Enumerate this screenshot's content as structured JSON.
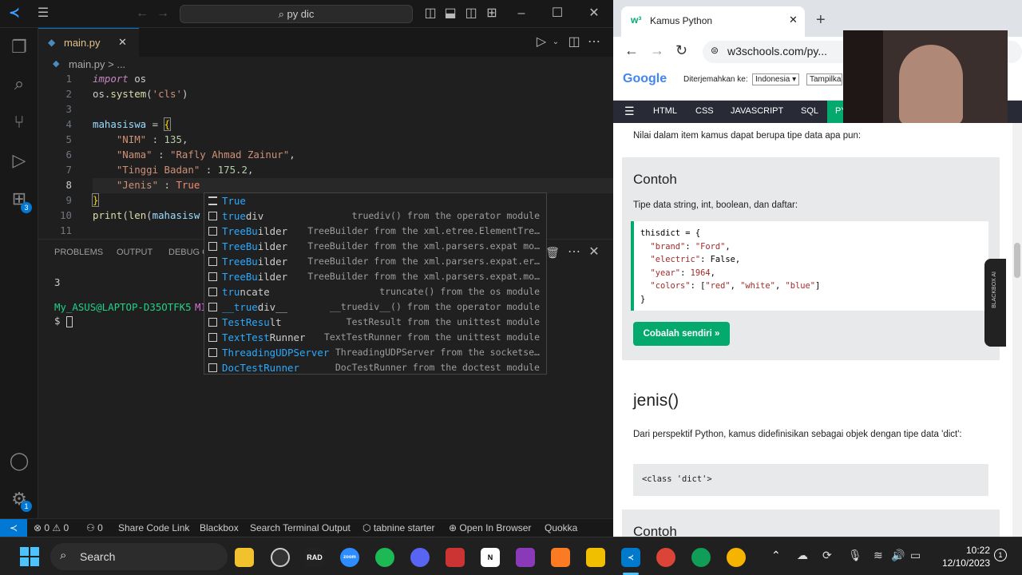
{
  "vscode": {
    "command_center": "py dic",
    "tab_label": "main.py",
    "breadcrumb": "main.py > ...",
    "line_numbers": [
      "1",
      "2",
      "3",
      "4",
      "5",
      "6",
      "7",
      "8",
      "9",
      "10",
      "11"
    ],
    "panel_tabs": [
      "PROBLEMS",
      "OUTPUT",
      "DEBUG C"
    ],
    "terminal": {
      "output": "3",
      "prompt_user": "My_ASUS@LAPTOP-D35OTFK5",
      "prompt_suffix": "MI",
      "prompt": "$"
    },
    "suggestions": [
      {
        "name": "True",
        "match": "True",
        "rest": "",
        "desc": "",
        "selected": true
      },
      {
        "name": "truediv",
        "match": "true",
        "rest": "div",
        "desc": "truediv() from the operator module"
      },
      {
        "name": "TreeBuilder",
        "match": "TreeBu",
        "rest": "ilder",
        "desc": "TreeBuilder from the xml.etree.ElementTre…"
      },
      {
        "name": "TreeBuilder",
        "match": "TreeBu",
        "rest": "ilder",
        "desc": "TreeBuilder from the xml.parsers.expat mo…"
      },
      {
        "name": "TreeBuilder",
        "match": "TreeBu",
        "rest": "ilder",
        "desc": "TreeBuilder from the xml.parsers.expat.er…"
      },
      {
        "name": "TreeBuilder",
        "match": "TreeBu",
        "rest": "ilder",
        "desc": "TreeBuilder from the xml.parsers.expat.mo…"
      },
      {
        "name": "truncate",
        "match": "tru",
        "rest": "ncate",
        "desc": "truncate() from the os module"
      },
      {
        "name": "__truediv__",
        "match": "__true",
        "rest": "div__",
        "desc": "__truediv__() from the operator module"
      },
      {
        "name": "TestResult",
        "match": "TestResu",
        "rest": "lt",
        "desc": "TestResult from the unittest module"
      },
      {
        "name": "TextTestRunner",
        "match": "TextTest",
        "rest": "Runner",
        "desc": "TextTestRunner from the unittest module"
      },
      {
        "name": "ThreadingUDPServer",
        "match": "ThreadingUDPServer",
        "rest": "",
        "desc": "ThreadingUDPServer from the socketse…"
      },
      {
        "name": "DocTestRunner",
        "match": "DocTestRunner",
        "rest": "",
        "desc": "DocTestRunner from the doctest module"
      }
    ],
    "status": {
      "errors": "0",
      "warnings": "0",
      "ports": "0",
      "items": [
        "Share Code Link",
        "Blackbox",
        "Search Terminal Output",
        "tabnine starter",
        "Open In Browser",
        "Quokka"
      ]
    },
    "badges": {
      "extensions": "3",
      "accounts": "1"
    }
  },
  "browser": {
    "tab_title": "Kamus Python",
    "url": "w3schools.com/py...",
    "translate": {
      "google": "Google",
      "label": "Diterjemahkan ke:",
      "lang": "Indonesia",
      "button": "Tampilka"
    },
    "nav": [
      "HTML",
      "CSS",
      "JAVASCRIPT",
      "SQL",
      "PY"
    ],
    "intro": "Nilai dalam item kamus dapat berupa tipe data apa pun:",
    "example1": {
      "heading": "Contoh",
      "desc": "Tipe data string, int, boolean, dan daftar:",
      "try": "Cobalah sendiri »"
    },
    "code": {
      "l1": "thisdict = {",
      "l6": "}"
    },
    "section": "jenis()",
    "section_desc": "Dari perspektif Python, kamus didefinisikan sebagai objek dengan tipe data 'dict':",
    "output_code": "<class 'dict'>",
    "example2_heading": "Contoh",
    "sidebar_tag": "BLACKBOX AI"
  },
  "taskbar": {
    "search": "Search",
    "time": "10:22",
    "date": "12/10/2023",
    "apps": [
      "RAD",
      "zoom"
    ]
  },
  "colors": {
    "w3green": "#04aa6d",
    "vscode_blue": "#0078d4"
  }
}
